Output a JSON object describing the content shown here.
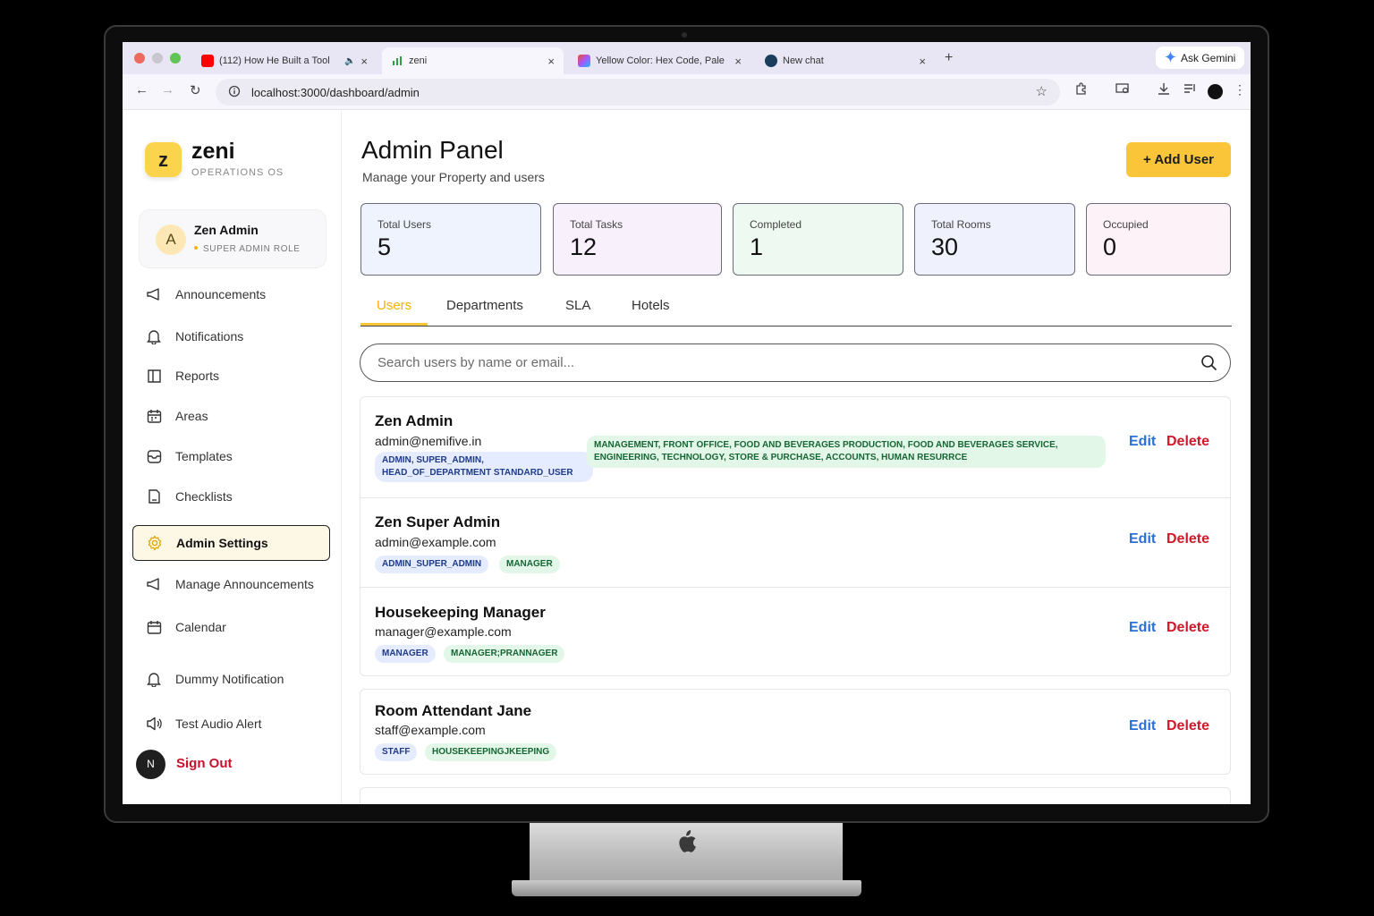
{
  "browser": {
    "tabs": [
      {
        "title": "(112) How He Built a Tool",
        "favicon": "youtube-icon"
      },
      {
        "title": "zeni",
        "favicon": "chart-icon"
      },
      {
        "title": "Yellow Color: Hex Code, Pale",
        "favicon": "figma-icon"
      },
      {
        "title": "New chat",
        "favicon": "chat-icon"
      }
    ],
    "gemini_label": "Ask Gemini",
    "url": "localhost:3000/dashboard/admin"
  },
  "sidebar": {
    "logo_letter": "z",
    "brand": "zeni",
    "brand_sub": "OPERATIONS OS",
    "user": {
      "initial": "A",
      "name": "Zen Admin",
      "role": "SUPER ADMIN ROLE"
    },
    "items": [
      {
        "label": "Announcements",
        "icon": "megaphone-icon"
      },
      {
        "label": "Notifications",
        "icon": "bell-icon"
      },
      {
        "label": "Reports",
        "icon": "book-icon"
      },
      {
        "label": "Areas",
        "icon": "calendar-grid-icon"
      },
      {
        "label": "Templates",
        "icon": "inbox-icon"
      },
      {
        "label": "Checklists",
        "icon": "clipboard-icon"
      },
      {
        "label": "Admin Settings",
        "icon": "gear-icon"
      },
      {
        "label": "Manage Announcements",
        "icon": "megaphone-icon"
      },
      {
        "label": "Calendar",
        "icon": "calendar-icon"
      },
      {
        "label": "Dummy Notification",
        "icon": "bell-icon"
      },
      {
        "label": "Test Audio Alert",
        "icon": "speaker-icon"
      }
    ],
    "signout": {
      "avatar": "N",
      "label": "Sign Out"
    }
  },
  "main": {
    "title": "Admin Panel",
    "subtitle": "Manage your Property and users",
    "add_user": "+ Add User",
    "stats": [
      {
        "label": "Total Users",
        "value": "5",
        "color": "#eef3fd"
      },
      {
        "label": "Total Tasks",
        "value": "12",
        "color": "#f8f0fb"
      },
      {
        "label": "Completed",
        "value": "1",
        "color": "#eefaf1"
      },
      {
        "label": "Total Rooms",
        "value": "30",
        "color": "#eff1fc"
      },
      {
        "label": "Occupied",
        "value": "0",
        "color": "#fdf2f7"
      }
    ],
    "tabs": [
      "Users",
      "Departments",
      "SLA",
      "Hotels"
    ],
    "search_placeholder": "Search users by name or email...",
    "users": [
      {
        "name": "Zen Admin",
        "email": "admin@nemifive.in",
        "roles_badge": "ADMIN, SUPER_ADMIN, HEAD_OF_DEPARTMENT STANDARD_USER",
        "dept_badge": "MANAGEMENT, FRONT OFFICE, FOOD AND BEVERAGES PRODUCTION, FOOD AND BEVERAGES SERVICE, ENGINEERING, TECHNOLOGY, STORE & PURCHASE, ACCOUNTS, HUMAN RESURRCE"
      },
      {
        "name": "Zen Super Admin",
        "email": "admin@example.com",
        "roles_badge": "ADMIN_SUPER_ADMIN",
        "dept_badge": "MANAGER"
      },
      {
        "name": "Housekeeping Manager",
        "email": "manager@example.com",
        "roles_badge": "MANAGER",
        "dept_badge": "MANAGER;PRANNAGER"
      },
      {
        "name": "Room Attendant Jane",
        "email": "staff@example.com",
        "roles_badge": "STAFF",
        "dept_badge": "HOUSEKEEPINGJKEEPING"
      }
    ],
    "edit_label": "Edit",
    "delete_label": "Delete"
  }
}
